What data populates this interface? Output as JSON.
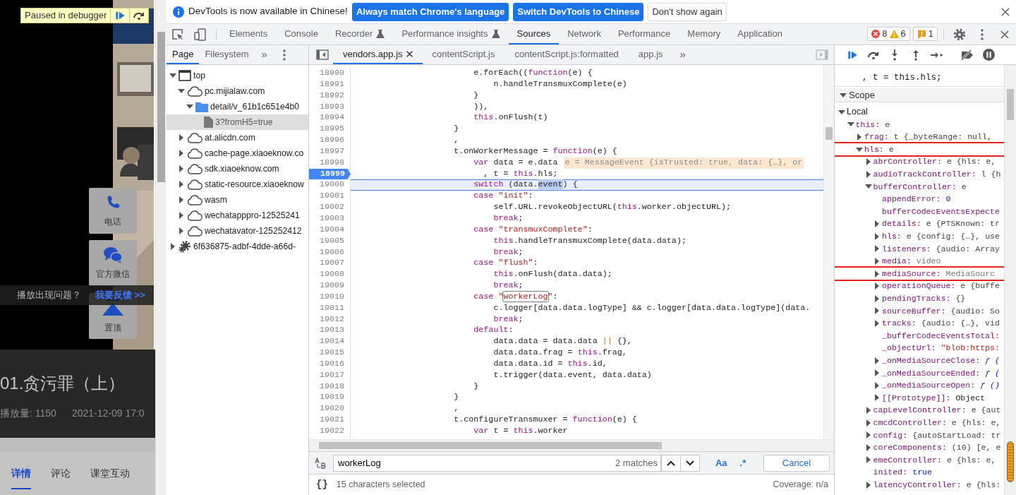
{
  "page": {
    "paused": {
      "label": "Paused in debugger"
    },
    "float_buttons": [
      {
        "label": "电话",
        "kind": "phone"
      },
      {
        "label": "官方微信",
        "kind": "chat"
      },
      {
        "label": "置顶",
        "kind": "top"
      }
    ],
    "feedback": {
      "question": "播放出现问题？",
      "link": "我要反馈 >>"
    },
    "title": "01.贪污罪（上）",
    "views": "播放量: 1150",
    "date": "2021-12-09 17:0",
    "tabs": [
      {
        "label": "详情",
        "selected": true
      },
      {
        "label": "评论",
        "selected": false
      },
      {
        "label": "课堂互动",
        "selected": false
      }
    ]
  },
  "infobar": {
    "message": "DevTools is now available in Chinese!",
    "buttons": [
      {
        "label": "Always match Chrome's language",
        "kind": "primary"
      },
      {
        "label": "Switch DevTools to Chinese",
        "kind": "primary"
      },
      {
        "label": "Don't show again",
        "kind": "secondary"
      }
    ]
  },
  "toolbar": {
    "tabs": [
      {
        "label": "Elements",
        "selected": false,
        "experimental": false
      },
      {
        "label": "Console",
        "selected": false,
        "experimental": false
      },
      {
        "label": "Recorder",
        "selected": false,
        "experimental": true
      },
      {
        "label": "Performance insights",
        "selected": false,
        "experimental": true
      },
      {
        "label": "Sources",
        "selected": true,
        "experimental": false
      },
      {
        "label": "Network",
        "selected": false,
        "experimental": false
      },
      {
        "label": "Performance",
        "selected": false,
        "experimental": false
      },
      {
        "label": "Memory",
        "selected": false,
        "experimental": false
      },
      {
        "label": "Application",
        "selected": false,
        "experimental": false
      }
    ],
    "errors": "8",
    "warnings": "6",
    "issues": "1"
  },
  "navigator": {
    "tabs": [
      {
        "label": "Page",
        "selected": true
      },
      {
        "label": "Filesystem",
        "selected": false
      }
    ],
    "overflow": "»",
    "tree": [
      {
        "label": "top",
        "kind": "frame",
        "expanded": true,
        "selected": false,
        "children": [
          {
            "label": "pc.mijialaw.com",
            "kind": "domain",
            "expanded": true,
            "selected": false,
            "children": [
              {
                "label": "detail/v_61b1c651e4b0",
                "kind": "folder",
                "expanded": true,
                "selected": false,
                "children": [
                  {
                    "label": "3?fromH5=true",
                    "kind": "file",
                    "selected": true
                  }
                ]
              }
            ]
          },
          {
            "label": "at.alicdn.com",
            "kind": "domain",
            "expanded": false,
            "selected": false
          },
          {
            "label": "cache-page.xiaoeknow.co",
            "kind": "domain",
            "expanded": false,
            "selected": false
          },
          {
            "label": "sdk.xiaoeknow.com",
            "kind": "domain",
            "expanded": false,
            "selected": false
          },
          {
            "label": "static-resource.xiaoeknow",
            "kind": "domain",
            "expanded": false,
            "selected": false
          },
          {
            "label": "wasm",
            "kind": "domain",
            "expanded": false,
            "selected": false
          },
          {
            "label": "wechatapppro-12525241",
            "kind": "domain",
            "expanded": false,
            "selected": false
          },
          {
            "label": "wechatavator-125252412",
            "kind": "domain",
            "expanded": false,
            "selected": false
          }
        ]
      },
      {
        "label": "6f636875-adbf-4dde-a66d-",
        "kind": "extension",
        "expanded": false,
        "selected": false
      }
    ]
  },
  "editor": {
    "tabs": [
      {
        "label": "vendors.app.js",
        "selected": true,
        "closable": true
      },
      {
        "label": "contentScript.js",
        "selected": false,
        "closable": false
      },
      {
        "label": "contentScript.js:formatted",
        "selected": false,
        "closable": false
      },
      {
        "label": "app.js",
        "selected": false,
        "closable": false
      }
    ],
    "overflow": "»",
    "lines": [
      {
        "num": "18990",
        "breakpoint": false,
        "current": false,
        "segments": [
          {
            "kind": "plain",
            "text": "                        e.forEach(("
          },
          {
            "kind": "keyword",
            "text": "function"
          },
          {
            "kind": "plain",
            "text": "(e) {"
          }
        ]
      },
      {
        "num": "18991",
        "breakpoint": false,
        "current": false,
        "segments": [
          {
            "kind": "plain",
            "text": "                            n.handleTransmuxComplete(e)"
          }
        ]
      },
      {
        "num": "18992",
        "breakpoint": false,
        "current": false,
        "segments": [
          {
            "kind": "plain",
            "text": "                        }"
          }
        ]
      },
      {
        "num": "18993",
        "breakpoint": false,
        "current": false,
        "segments": [
          {
            "kind": "plain",
            "text": "                        )),"
          }
        ]
      },
      {
        "num": "18994",
        "breakpoint": false,
        "current": false,
        "segments": [
          {
            "kind": "keyword",
            "text": "                        this"
          },
          {
            "kind": "plain",
            "text": ".onFlush(t)"
          }
        ]
      },
      {
        "num": "18995",
        "breakpoint": false,
        "current": false,
        "segments": [
          {
            "kind": "plain",
            "text": "                    }"
          }
        ]
      },
      {
        "num": "18996",
        "breakpoint": false,
        "current": false,
        "segments": [
          {
            "kind": "plain",
            "text": "                    ,"
          }
        ]
      },
      {
        "num": "18997",
        "breakpoint": false,
        "current": false,
        "segments": [
          {
            "kind": "plain",
            "text": "                    t.onWorkerMessage = "
          },
          {
            "kind": "keyword",
            "text": "function"
          },
          {
            "kind": "plain",
            "text": "(e) {"
          }
        ]
      },
      {
        "num": "18998",
        "breakpoint": false,
        "current": false,
        "segments": [
          {
            "kind": "keyword",
            "text": "                        var"
          },
          {
            "kind": "plain",
            "text": " data = e.data"
          }
        ],
        "inline_value": "e = MessageEvent {isTrusted: true, data: {…}, or"
      },
      {
        "num": "18999",
        "breakpoint": true,
        "current": false,
        "segments": [
          {
            "kind": "plain",
            "text": "                          , t = "
          },
          {
            "kind": "keyword",
            "text": "this"
          },
          {
            "kind": "plain",
            "text": ".hls;"
          }
        ]
      },
      {
        "num": "19000",
        "breakpoint": false,
        "current": true,
        "segments": [
          {
            "kind": "keyword",
            "text": "                        switch"
          },
          {
            "kind": "plain",
            "text": " (data."
          },
          {
            "kind": "selection",
            "text": "event"
          },
          {
            "kind": "plain",
            "text": ") {"
          }
        ]
      },
      {
        "num": "19001",
        "breakpoint": false,
        "current": false,
        "segments": [
          {
            "kind": "keyword",
            "text": "                        case "
          },
          {
            "kind": "string",
            "text": "\"init\""
          },
          {
            "kind": "plain",
            "text": ":"
          }
        ]
      },
      {
        "num": "19002",
        "breakpoint": false,
        "current": false,
        "segments": [
          {
            "kind": "plain",
            "text": "                            self.URL.revokeObjectURL("
          },
          {
            "kind": "keyword",
            "text": "this"
          },
          {
            "kind": "plain",
            "text": ".worker.objectURL);"
          }
        ]
      },
      {
        "num": "19003",
        "breakpoint": false,
        "current": false,
        "segments": [
          {
            "kind": "keyword",
            "text": "                            break"
          },
          {
            "kind": "plain",
            "text": ";"
          }
        ]
      },
      {
        "num": "19004",
        "breakpoint": false,
        "current": false,
        "segments": [
          {
            "kind": "keyword",
            "text": "                        case "
          },
          {
            "kind": "string",
            "text": "\"transmuxComplete\""
          },
          {
            "kind": "plain",
            "text": ":"
          }
        ]
      },
      {
        "num": "19005",
        "breakpoint": false,
        "current": false,
        "segments": [
          {
            "kind": "keyword",
            "text": "                            this"
          },
          {
            "kind": "plain",
            "text": ".handleTransmuxComplete(data.data);"
          }
        ]
      },
      {
        "num": "19006",
        "breakpoint": false,
        "current": false,
        "segments": [
          {
            "kind": "keyword",
            "text": "                            break"
          },
          {
            "kind": "plain",
            "text": ";"
          }
        ]
      },
      {
        "num": "19007",
        "breakpoint": false,
        "current": false,
        "segments": [
          {
            "kind": "keyword",
            "text": "                        case "
          },
          {
            "kind": "string",
            "text": "\"flush\""
          },
          {
            "kind": "plain",
            "text": ":"
          }
        ]
      },
      {
        "num": "19008",
        "breakpoint": false,
        "current": false,
        "segments": [
          {
            "kind": "keyword",
            "text": "                            this"
          },
          {
            "kind": "plain",
            "text": ".onFlush(data.data);"
          }
        ]
      },
      {
        "num": "19009",
        "breakpoint": false,
        "current": false,
        "segments": [
          {
            "kind": "keyword",
            "text": "                            break"
          },
          {
            "kind": "plain",
            "text": ";"
          }
        ]
      },
      {
        "num": "19010",
        "breakpoint": false,
        "current": false,
        "segments": [
          {
            "kind": "keyword",
            "text": "                        case "
          },
          {
            "kind": "string",
            "text": "\""
          },
          {
            "kind": "match",
            "text": "workerLog"
          },
          {
            "kind": "string",
            "text": "\""
          },
          {
            "kind": "plain",
            "text": ":"
          }
        ]
      },
      {
        "num": "19011",
        "breakpoint": false,
        "current": false,
        "segments": [
          {
            "kind": "plain",
            "text": "                            c.logger[data.data.logType] && c.logger[data.data.logType](data."
          }
        ]
      },
      {
        "num": "19012",
        "breakpoint": false,
        "current": false,
        "segments": [
          {
            "kind": "keyword",
            "text": "                            break"
          },
          {
            "kind": "plain",
            "text": ";"
          }
        ]
      },
      {
        "num": "19013",
        "breakpoint": false,
        "current": false,
        "segments": [
          {
            "kind": "keyword",
            "text": "                        default"
          },
          {
            "kind": "plain",
            "text": ":"
          }
        ]
      },
      {
        "num": "19014",
        "breakpoint": false,
        "current": false,
        "segments": [
          {
            "kind": "plain",
            "text": "                            data.data = data.data "
          },
          {
            "kind": "operator",
            "text": "||"
          },
          {
            "kind": "plain",
            "text": " {},"
          }
        ]
      },
      {
        "num": "19015",
        "breakpoint": false,
        "current": false,
        "segments": [
          {
            "kind": "plain",
            "text": "                            data.data.frag = "
          },
          {
            "kind": "keyword",
            "text": "this"
          },
          {
            "kind": "plain",
            "text": ".frag,"
          }
        ]
      },
      {
        "num": "19016",
        "breakpoint": false,
        "current": false,
        "segments": [
          {
            "kind": "plain",
            "text": "                            data.data.id = "
          },
          {
            "kind": "keyword",
            "text": "this"
          },
          {
            "kind": "plain",
            "text": ".id,"
          }
        ]
      },
      {
        "num": "19017",
        "breakpoint": false,
        "current": false,
        "segments": [
          {
            "kind": "plain",
            "text": "                            t.trigger(data.event, data.data)"
          }
        ]
      },
      {
        "num": "19018",
        "breakpoint": false,
        "current": false,
        "segments": [
          {
            "kind": "plain",
            "text": "                        }"
          }
        ]
      },
      {
        "num": "19019",
        "breakpoint": false,
        "current": false,
        "segments": [
          {
            "kind": "plain",
            "text": "                    }"
          }
        ]
      },
      {
        "num": "19020",
        "breakpoint": false,
        "current": false,
        "segments": [
          {
            "kind": "plain",
            "text": "                    ,"
          }
        ]
      },
      {
        "num": "19021",
        "breakpoint": false,
        "current": false,
        "segments": [
          {
            "kind": "plain",
            "text": "                    t.configureTransmuxer = "
          },
          {
            "kind": "keyword",
            "text": "function"
          },
          {
            "kind": "plain",
            "text": "(e) {"
          }
        ]
      },
      {
        "num": "19022",
        "breakpoint": false,
        "current": false,
        "segments": [
          {
            "kind": "keyword",
            "text": "                        var"
          },
          {
            "kind": "plain",
            "text": " t = "
          },
          {
            "kind": "keyword",
            "text": "this"
          },
          {
            "kind": "plain",
            "text": ".worker"
          }
        ]
      }
    ],
    "search": {
      "value": "workerLog",
      "matches": "2 matches",
      "case_toggle": "Aa",
      "regex_toggle": ".*",
      "cancel": "Cancel"
    },
    "status": {
      "pretty_print": "{}",
      "selection": "15 characters selected",
      "coverage": "Coverage: n/a"
    }
  },
  "debugger": {
    "snippet": ", t = this.hls;",
    "scope_title": "Scope",
    "scope": [
      {
        "key": "Local",
        "expanded": true,
        "children": [
          {
            "key": "this:",
            "value": "e",
            "expanded": true,
            "children": [
              {
                "key": "frag:",
                "value": "t {_byteRange: null,",
                "expanded": false
              },
              {
                "key": "hls:",
                "value": "e",
                "expanded": true,
                "highlighted": true,
                "children": [
                  {
                    "key": "abrController:",
                    "value": "e {hls: e,",
                    "expanded": false
                  },
                  {
                    "key": "audioTrackController:",
                    "value": "l {h",
                    "expanded": false
                  },
                  {
                    "key": "bufferController:",
                    "value": "e",
                    "expanded": true,
                    "children": [
                      {
                        "key": "appendError:",
                        "value": "0",
                        "kind": "number"
                      },
                      {
                        "key": "bufferCodecEventsExpecte"
                      },
                      {
                        "key": "details:",
                        "value": "e {PTSKnown: tr",
                        "expanded": false,
                        "kind": "object"
                      },
                      {
                        "key": "hls:",
                        "value": "e {config: {…}, use",
                        "expanded": false,
                        "kind": "object"
                      },
                      {
                        "key": "listeners:",
                        "value": "{audio: Array",
                        "expanded": false,
                        "kind": "object"
                      },
                      {
                        "key": "media:",
                        "value": "video",
                        "expanded": false,
                        "kind": "node"
                      },
                      {
                        "key": "mediaSource:",
                        "value": "MediaSourc",
                        "expanded": false,
                        "highlighted": true,
                        "kind": "node"
                      },
                      {
                        "key": "operationQueue:",
                        "value": "e {buffe",
                        "expanded": false,
                        "kind": "object"
                      },
                      {
                        "key": "pendingTracks:",
                        "value": "{}",
                        "expanded": false,
                        "kind": "object"
                      },
                      {
                        "key": "sourceBuffer:",
                        "value": "{audio: So",
                        "expanded": false,
                        "kind": "object"
                      },
                      {
                        "key": "tracks:",
                        "value": "{audio: {…}, vid",
                        "expanded": false,
                        "kind": "object"
                      },
                      {
                        "key": "_bufferCodecEventsTotal:"
                      },
                      {
                        "key": "_objectUrl:",
                        "value": "\"blob:https:",
                        "kind": "string"
                      },
                      {
                        "key": "_onMediaSourceClose:",
                        "value": "ƒ (",
                        "expanded": false,
                        "kind": "function"
                      },
                      {
                        "key": "_onMediaSourceEnded:",
                        "value": "ƒ (",
                        "expanded": false,
                        "kind": "function"
                      },
                      {
                        "key": "_onMediaSourceOpen:",
                        "value": "ƒ ()",
                        "expanded": false,
                        "kind": "function"
                      },
                      {
                        "key": "[[Prototype]]:",
                        "value": "Object",
                        "expanded": false,
                        "kind": "internal"
                      }
                    ]
                  },
                  {
                    "key": "capLevelController:",
                    "value": "e {aut",
                    "expanded": false
                  },
                  {
                    "key": "cmcdController:",
                    "value": "e {hls: e,",
                    "expanded": false
                  },
                  {
                    "key": "config:",
                    "value": "{autoStartLoad: tr",
                    "expanded": false
                  },
                  {
                    "key": "coreComponents:",
                    "value": "(10) [e, e",
                    "expanded": false
                  },
                  {
                    "key": "emeController:",
                    "value": "e {hls: e,",
                    "expanded": false
                  },
                  {
                    "key": "inited:",
                    "value": "true",
                    "kind": "boolean"
                  },
                  {
                    "key": "latencyController:",
                    "value": "e {hls:",
                    "expanded": false
                  }
                ]
              }
            ]
          }
        ]
      }
    ]
  }
}
